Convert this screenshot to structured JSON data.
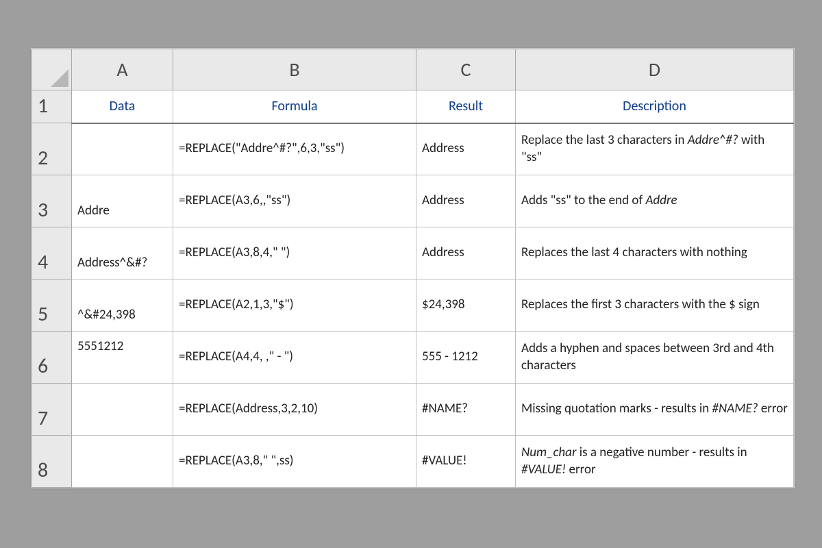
{
  "columns": [
    "A",
    "B",
    "C",
    "D"
  ],
  "row_numbers": [
    "1",
    "2",
    "3",
    "4",
    "5",
    "6",
    "7",
    "8"
  ],
  "header_row": {
    "A": "Data",
    "B": "Formula",
    "C": "Result",
    "D": "Description"
  },
  "rows": [
    {
      "A": "",
      "B": "=REPLACE(\"Addre^#?\",6,3,\"ss\")",
      "C": "Address",
      "D_pre": "Replace the last 3 characters in ",
      "D_ital": "Addre^#?",
      "D_post": " with \"ss\""
    },
    {
      "A": "Addre",
      "B": "=REPLACE(A3,6,,\"ss\")",
      "C": "Address",
      "D_pre": "Adds \"ss\" to the end of ",
      "D_ital": "Addre",
      "D_post": ""
    },
    {
      "A": "Address^&#?",
      "B": "=REPLACE(A3,8,4,\" \")",
      "C": "Address",
      "D_pre": "Replaces the last 4 characters with nothing",
      "D_ital": "",
      "D_post": ""
    },
    {
      "A": "^&#24,398",
      "B": "=REPLACE(A2,1,3,\"$\")",
      "C": "$24,398",
      "D_pre": "Replaces the first 3 characters with the $ sign",
      "D_ital": "",
      "D_post": ""
    },
    {
      "A": "5551212",
      "B": "=REPLACE(A4,4, ,\" - \")",
      "C": "555 - 1212",
      "D_pre": "Adds a hyphen and spaces between 3rd and 4th characters",
      "D_ital": "",
      "D_post": ""
    },
    {
      "A": "",
      "B": "=REPLACE(Address,3,2,10)",
      "C": "#NAME?",
      "D_pre": "Missing quotation marks - results in ",
      "D_ital": "#NAME?",
      "D_post": "  error"
    },
    {
      "A": "",
      "B": "=REPLACE(A3,8,\" \",ss)",
      "C": "#VALUE!",
      "D_pre2": "",
      "D_ital2": "Num_char",
      "D_mid2": "  is a negative number - results in ",
      "D_ital2b": "#VALUE!",
      "D_post2": "  error"
    }
  ]
}
